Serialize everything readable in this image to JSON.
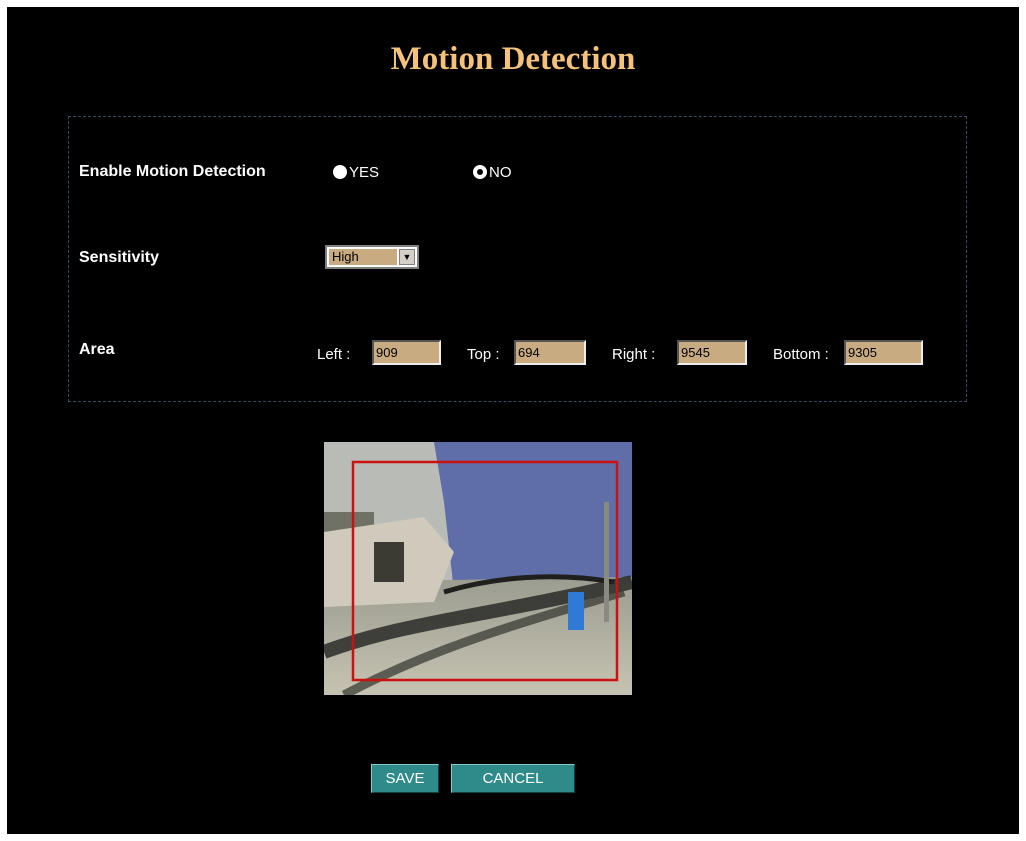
{
  "page": {
    "title": "Motion Detection"
  },
  "enable": {
    "label": "Enable Motion Detection",
    "yes_label": "YES",
    "no_label": "NO",
    "selected": "NO"
  },
  "sensitivity": {
    "label": "Sensitivity",
    "value": "High",
    "arrow": "▼"
  },
  "area": {
    "label": "Area",
    "left_label": "Left :",
    "left_value": "909",
    "top_label": "Top :",
    "top_value": "694",
    "right_label": "Right :",
    "right_value": "9545",
    "bottom_label": "Bottom :",
    "bottom_value": "9305"
  },
  "buttons": {
    "save_label": "SAVE",
    "cancel_label": "CANCEL"
  },
  "colors": {
    "title": "#f5c27a",
    "field_bg": "#c9ab82",
    "button_bg": "#2f8a8a",
    "area_box": "#cc1111"
  }
}
